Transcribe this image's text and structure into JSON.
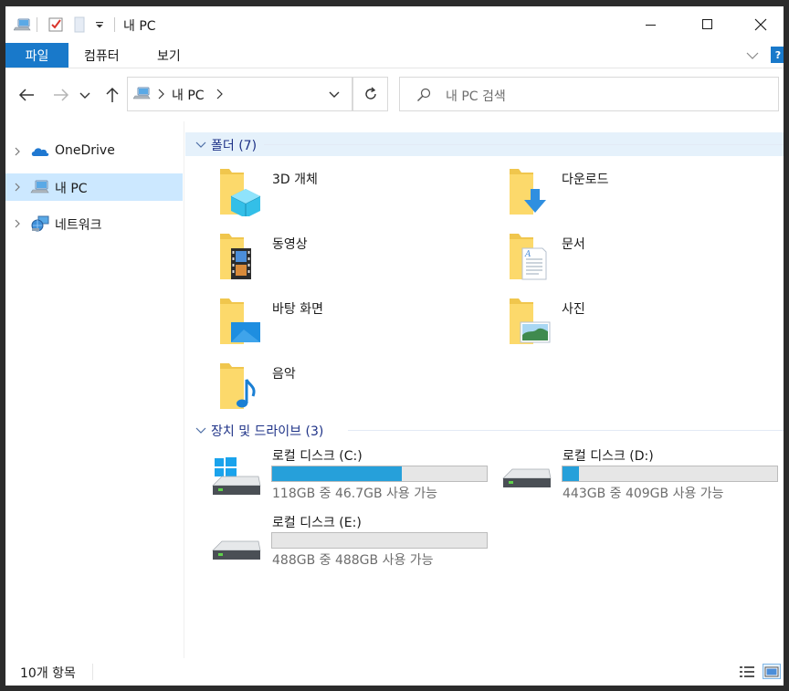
{
  "window": {
    "title": "내 PC"
  },
  "ribbon": {
    "tabs": {
      "file": "파일",
      "computer": "컴퓨터",
      "view": "보기"
    },
    "help": "?"
  },
  "address": {
    "location": "내 PC"
  },
  "search": {
    "placeholder": "내 PC 검색"
  },
  "sidebar": {
    "items": [
      {
        "label": "OneDrive",
        "icon": "onedrive-cloud-icon",
        "selected": false
      },
      {
        "label": "내 PC",
        "icon": "this-pc-icon",
        "selected": true
      },
      {
        "label": "네트워크",
        "icon": "network-icon",
        "selected": false
      }
    ]
  },
  "groups": {
    "folders": {
      "title": "폴더 (7)"
    },
    "drives": {
      "title": "장치 및 드라이브 (3)"
    }
  },
  "folders": [
    {
      "name": "3D 개체",
      "icon": "3d-objects-folder-icon"
    },
    {
      "name": "다운로드",
      "icon": "downloads-folder-icon"
    },
    {
      "name": "동영상",
      "icon": "videos-folder-icon"
    },
    {
      "name": "문서",
      "icon": "documents-folder-icon"
    },
    {
      "name": "바탕 화면",
      "icon": "desktop-folder-icon"
    },
    {
      "name": "사진",
      "icon": "pictures-folder-icon"
    },
    {
      "name": "음악",
      "icon": "music-folder-icon"
    }
  ],
  "drives": [
    {
      "name": "로컬 디스크 (C:)",
      "free_text": "118GB 중 46.7GB 사용 가능",
      "used_fraction": 0.604,
      "icon": "windows-system-drive-icon"
    },
    {
      "name": "로컬 디스크 (D:)",
      "free_text": "443GB 중 409GB 사용 가능",
      "used_fraction": 0.077,
      "icon": "hard-drive-icon"
    },
    {
      "name": "로컬 디스크 (E:)",
      "free_text": "488GB 중 488GB 사용 가능",
      "used_fraction": 0.0,
      "icon": "hard-drive-icon"
    }
  ],
  "status": {
    "item_count": "10개 항목"
  },
  "colors": {
    "accent": "#1979ca",
    "selection": "#cce8ff",
    "drive_bar": "#26a0da",
    "group_title": "#1e3287"
  }
}
